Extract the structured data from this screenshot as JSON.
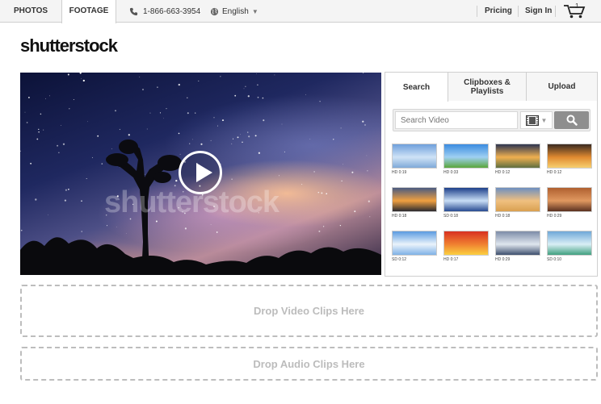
{
  "topbar": {
    "tabs": [
      "PHOTOS",
      "FOOTAGE"
    ],
    "phone": "1-866-663-3954",
    "language": "English",
    "pricing": "Pricing",
    "sign_in": "Sign In",
    "cart_count": "1",
    "icons": [
      "phone-icon",
      "globe-icon",
      "chevron-down-icon",
      "cart-icon"
    ]
  },
  "logo": "shutterstock",
  "video": {
    "watermark": "shutterstock",
    "play_icon": "play-icon"
  },
  "panel": {
    "tabs": [
      "Search",
      "Clipboxes & Playlists",
      "Upload"
    ],
    "search_placeholder": "Search Video",
    "type_icon": "film-icon",
    "search_icon": "search-icon",
    "thumbnails": [
      {
        "meta": "HD 0:19",
        "colors": [
          "#6f9fdc",
          "#cfe3f6",
          "#7fa9d8"
        ]
      },
      {
        "meta": "HD 0:33",
        "colors": [
          "#3b8be0",
          "#9fd0f2",
          "#5aa63a"
        ]
      },
      {
        "meta": "HD 0:12",
        "colors": [
          "#2d3550",
          "#f0b050",
          "#5f6f40"
        ]
      },
      {
        "meta": "HD 0:12",
        "colors": [
          "#3a2a20",
          "#e08a30",
          "#f7d070"
        ]
      },
      {
        "meta": "HD 0:18",
        "colors": [
          "#4a5a80",
          "#f0a040",
          "#2a2a30"
        ]
      },
      {
        "meta": "SD 0:18",
        "colors": [
          "#1d3f8a",
          "#c9def6",
          "#284a90"
        ]
      },
      {
        "meta": "HD 0:18",
        "colors": [
          "#6d8fc0",
          "#f0c080",
          "#d9a050"
        ]
      },
      {
        "meta": "HD 0:29",
        "colors": [
          "#b06030",
          "#e09860",
          "#5a3020"
        ]
      },
      {
        "meta": "SD 0:12",
        "colors": [
          "#5b9be0",
          "#eaf3fb",
          "#7fb2e6"
        ]
      },
      {
        "meta": "HD 0:17",
        "colors": [
          "#d83020",
          "#f08030",
          "#fbd040"
        ]
      },
      {
        "meta": "HD 0:29",
        "colors": [
          "#7d8ca8",
          "#dfe6ee",
          "#3e4f6e"
        ]
      },
      {
        "meta": "SD 0:10",
        "colors": [
          "#6fa8d8",
          "#d9eef5",
          "#40a080"
        ]
      }
    ]
  },
  "drop_video": "Drop Video Clips Here",
  "drop_audio": "Drop Audio Clips Here"
}
